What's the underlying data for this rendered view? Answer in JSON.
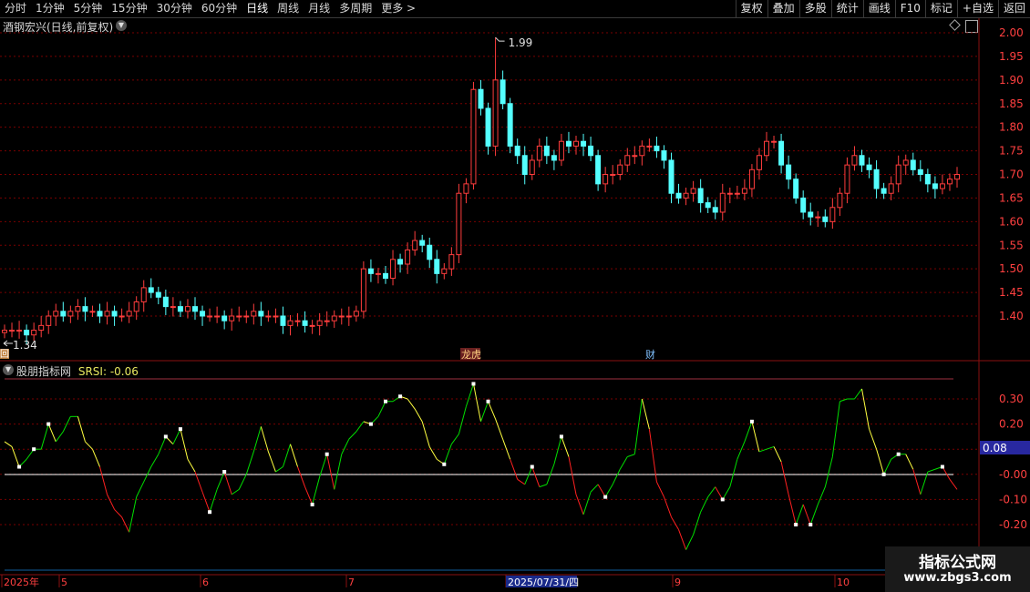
{
  "toolbar": {
    "periods": [
      "分时",
      "1分钟",
      "5分钟",
      "15分钟",
      "30分钟",
      "60分钟",
      "日线",
      "周线",
      "月线",
      "多周期",
      "更多 >"
    ],
    "active_period": "日线",
    "buttons": [
      "复权",
      "叠加",
      "多股",
      "统计",
      "画线",
      "F10",
      "标记",
      "+自选",
      "返回"
    ]
  },
  "stock_title": "酒钢宏兴(日线,前复权)",
  "price_axis": [
    "2.00",
    "1.95",
    "1.90",
    "1.85",
    "1.80",
    "1.75",
    "1.70",
    "1.65",
    "1.60",
    "1.55",
    "1.50",
    "1.45",
    "1.40"
  ],
  "high_label": "1.99",
  "low_label": "1.34",
  "event_labels": [
    "龙虎",
    "财"
  ],
  "hui_label": "回",
  "indicator": {
    "name": "股朋指标网",
    "series": "SRSI",
    "value": "-0.06",
    "axis": [
      "0.30",
      "0.20",
      "0.10",
      "-0.00",
      "-0.10",
      "-0.20"
    ],
    "current_badge": "0.08"
  },
  "date_axis": [
    "2025年",
    "5",
    "6",
    "7",
    "2025/07/31/四",
    "9",
    "10"
  ],
  "watermark": {
    "title": "指标公式网",
    "url": "www.zbgs3.com"
  },
  "colors": {
    "up": "#ff3d3d",
    "down": "#54ffff",
    "line_green": "#00e000",
    "line_yellow": "#ffff40",
    "line_red": "#ff2020",
    "grid": "#7a0000",
    "badge": "#2828a0"
  },
  "chart_data": [
    {
      "type": "candlestick",
      "title": "酒钢宏兴(日线,前复权)",
      "ylim": [
        1.34,
        2.01
      ],
      "high": 1.99,
      "low": 1.34,
      "closes": [
        1.37,
        1.37,
        1.37,
        1.36,
        1.37,
        1.38,
        1.4,
        1.41,
        1.4,
        1.41,
        1.42,
        1.41,
        1.41,
        1.4,
        1.41,
        1.4,
        1.4,
        1.41,
        1.43,
        1.46,
        1.45,
        1.44,
        1.42,
        1.42,
        1.41,
        1.42,
        1.41,
        1.4,
        1.4,
        1.4,
        1.39,
        1.4,
        1.4,
        1.4,
        1.41,
        1.4,
        1.4,
        1.4,
        1.38,
        1.39,
        1.39,
        1.38,
        1.38,
        1.39,
        1.39,
        1.4,
        1.4,
        1.4,
        1.41,
        1.5,
        1.49,
        1.49,
        1.48,
        1.52,
        1.51,
        1.54,
        1.56,
        1.55,
        1.52,
        1.49,
        1.5,
        1.53,
        1.66,
        1.68,
        1.88,
        1.84,
        1.76,
        1.9,
        1.85,
        1.76,
        1.74,
        1.7,
        1.73,
        1.76,
        1.74,
        1.73,
        1.77,
        1.76,
        1.77,
        1.76,
        1.74,
        1.68,
        1.7,
        1.7,
        1.72,
        1.74,
        1.74,
        1.76,
        1.76,
        1.75,
        1.73,
        1.66,
        1.65,
        1.66,
        1.67,
        1.64,
        1.63,
        1.62,
        1.66,
        1.66,
        1.66,
        1.67,
        1.71,
        1.74,
        1.77,
        1.77,
        1.72,
        1.69,
        1.65,
        1.62,
        1.61,
        1.61,
        1.6,
        1.63,
        1.66,
        1.72,
        1.74,
        1.72,
        1.71,
        1.67,
        1.66,
        1.68,
        1.72,
        1.73,
        1.71,
        1.7,
        1.68,
        1.67,
        1.68,
        1.69,
        1.7
      ]
    },
    {
      "type": "line",
      "title": "股朋指标网 SRSI",
      "ylim": [
        -0.29,
        0.39
      ],
      "values": [
        0.13,
        0.11,
        0.03,
        0.06,
        0.1,
        0.1,
        0.2,
        0.13,
        0.17,
        0.23,
        0.23,
        0.13,
        0.1,
        0.03,
        -0.08,
        -0.14,
        -0.17,
        -0.23,
        -0.09,
        -0.03,
        0.03,
        0.08,
        0.15,
        0.12,
        0.18,
        0.06,
        0.01,
        -0.07,
        -0.15,
        -0.06,
        0.01,
        -0.08,
        -0.06,
        0.0,
        0.09,
        0.19,
        0.09,
        0.01,
        0.03,
        0.12,
        0.03,
        -0.05,
        -0.12,
        -0.01,
        0.08,
        -0.06,
        0.08,
        0.14,
        0.17,
        0.21,
        0.2,
        0.23,
        0.29,
        0.29,
        0.31,
        0.3,
        0.26,
        0.21,
        0.11,
        0.06,
        0.04,
        0.12,
        0.16,
        0.27,
        0.36,
        0.21,
        0.29,
        0.22,
        0.14,
        0.06,
        -0.02,
        -0.04,
        0.03,
        -0.05,
        -0.04,
        0.04,
        0.15,
        0.07,
        -0.08,
        -0.16,
        -0.07,
        -0.04,
        -0.09,
        -0.04,
        0.02,
        0.07,
        0.08,
        0.3,
        0.18,
        -0.03,
        -0.09,
        -0.17,
        -0.22,
        -0.3,
        -0.24,
        -0.15,
        -0.09,
        -0.05,
        -0.1,
        -0.05,
        0.06,
        0.13,
        0.21,
        0.09,
        0.1,
        0.11,
        0.05,
        -0.08,
        -0.2,
        -0.12,
        -0.2,
        -0.12,
        -0.05,
        0.07,
        0.29,
        0.3,
        0.3,
        0.34,
        0.18,
        0.1,
        0.0,
        0.06,
        0.08,
        0.08,
        0.02,
        -0.08,
        0.01,
        0.02,
        0.03,
        -0.02,
        -0.06
      ]
    }
  ]
}
